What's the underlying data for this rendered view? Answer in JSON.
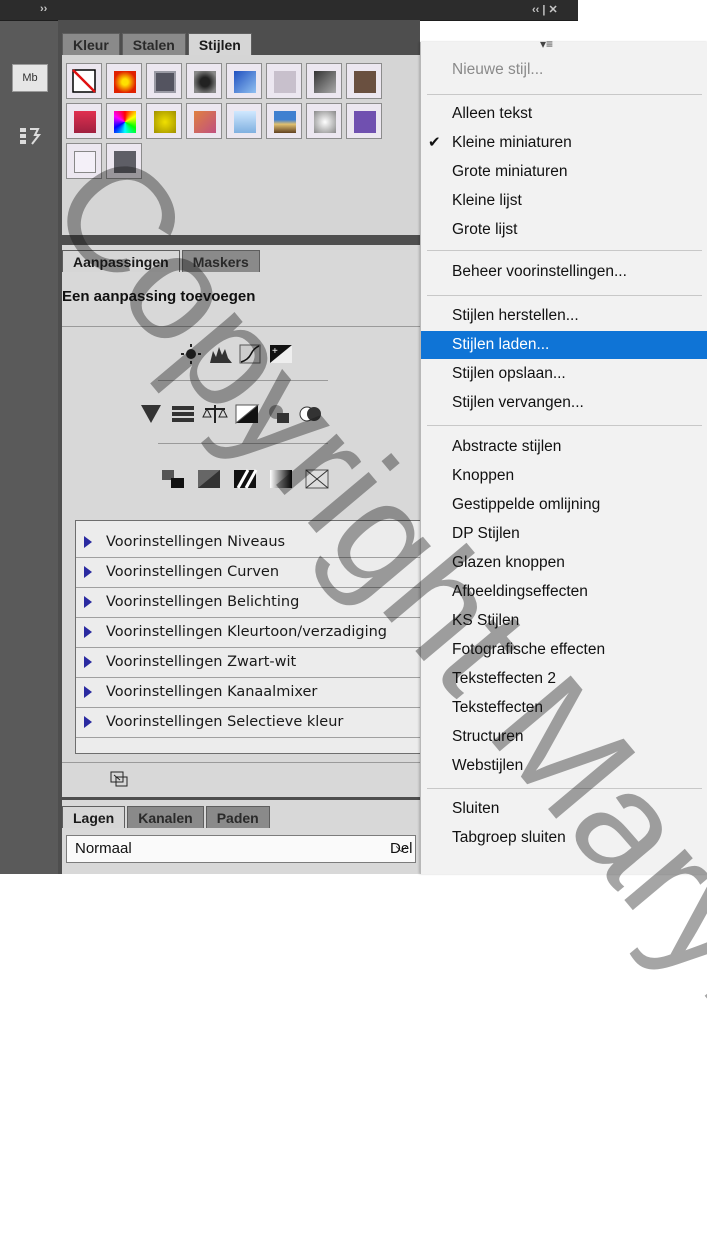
{
  "left_panel": {
    "badge_mb": "Mb"
  },
  "styles_panel": {
    "tabs": [
      {
        "label": "Kleur",
        "active": false
      },
      {
        "label": "Stalen",
        "active": false
      },
      {
        "label": "Stijlen",
        "active": true
      }
    ]
  },
  "adjustments_panel": {
    "tabs": [
      {
        "label": "Aanpassingen",
        "active": true
      },
      {
        "label": "Maskers",
        "active": false
      }
    ],
    "title": "Een aanpassing toevoegen",
    "presets": [
      "Voorinstellingen Niveaus",
      "Voorinstellingen Curven",
      "Voorinstellingen Belichting",
      "Voorinstellingen Kleurtoon/verzadiging",
      "Voorinstellingen Zwart-wit",
      "Voorinstellingen Kanaalmixer",
      "Voorinstellingen Selectieve kleur"
    ]
  },
  "layers_panel": {
    "tabs": [
      {
        "label": "Lagen",
        "active": true
      },
      {
        "label": "Kanalen",
        "active": false
      },
      {
        "label": "Paden",
        "active": false
      }
    ],
    "blend_mode": "Normaal",
    "opacity_label_partial": "Del"
  },
  "context_menu": {
    "groups": [
      [
        {
          "label": "Nieuwe stijl...",
          "disabled": true
        }
      ],
      [
        {
          "label": "Alleen tekst"
        },
        {
          "label": "Kleine miniaturen",
          "checked": true
        },
        {
          "label": "Grote miniaturen"
        },
        {
          "label": "Kleine lijst"
        },
        {
          "label": "Grote lijst"
        }
      ],
      [
        {
          "label": "Beheer voorinstellingen..."
        }
      ],
      [
        {
          "label": "Stijlen herstellen..."
        },
        {
          "label": "Stijlen laden...",
          "highlighted": true
        },
        {
          "label": "Stijlen opslaan..."
        },
        {
          "label": "Stijlen vervangen..."
        }
      ],
      [
        {
          "label": "Abstracte stijlen"
        },
        {
          "label": "Knoppen"
        },
        {
          "label": "Gestippelde omlijning"
        },
        {
          "label": "DP Stijlen"
        },
        {
          "label": "Glazen knoppen"
        },
        {
          "label": "Afbeeldingseffecten"
        },
        {
          "label": "KS Stijlen"
        },
        {
          "label": "Fotografische effecten"
        },
        {
          "label": "Teksteffecten 2"
        },
        {
          "label": "Teksteffecten"
        },
        {
          "label": "Structuren"
        },
        {
          "label": "Webstijlen"
        }
      ],
      [
        {
          "label": "Sluiten"
        },
        {
          "label": "Tabgroep sluiten"
        }
      ]
    ]
  },
  "watermark": {
    "text": "Copyright Maryrose"
  },
  "colors": {
    "highlight": "#0f74d6",
    "dark_panel": "#4e4e4e",
    "light_panel": "#d8d8d8"
  }
}
